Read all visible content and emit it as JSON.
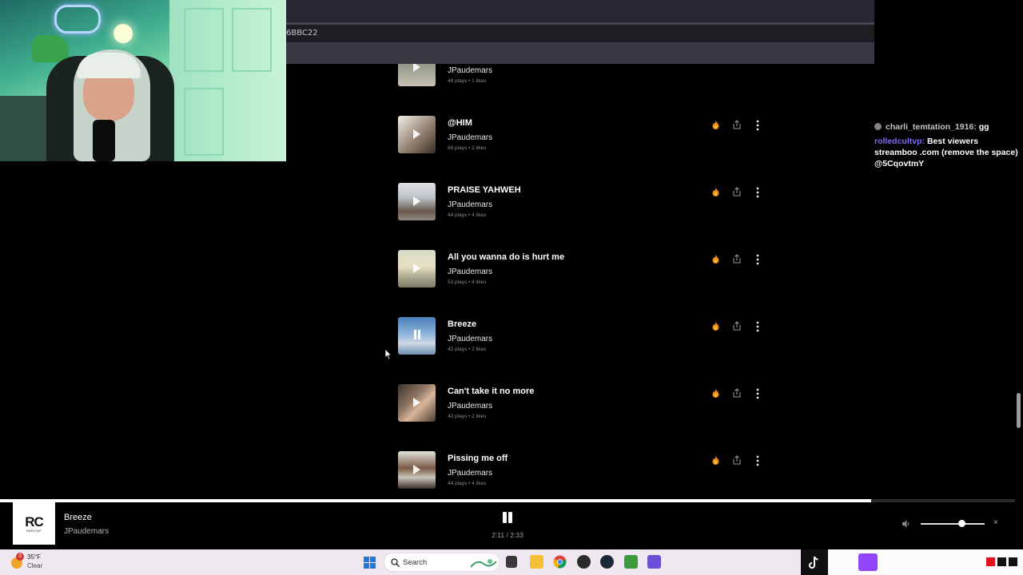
{
  "browser": {
    "url_fragment": "6BBC22"
  },
  "chat": {
    "messages": [
      {
        "user": "charli_temtation_1916:",
        "text": "gg"
      },
      {
        "user": "rolledcultvp:",
        "text": "Best viewers streamboo .com (remove the space) @5CqovtmY"
      }
    ]
  },
  "tracks": [
    {
      "title": "",
      "artist": "JPaudemars",
      "stats": "48 plays • 1 likes"
    },
    {
      "title": "@HIM",
      "artist": "JPaudemars",
      "stats": "66 plays • 2 likes"
    },
    {
      "title": "PRAISE YAHWEH",
      "artist": "JPaudemars",
      "stats": "44 plays • 4 likes"
    },
    {
      "title": "All you wanna do is hurt me",
      "artist": "JPaudemars",
      "stats": "53 plays • 4 likes"
    },
    {
      "title": "Breeze",
      "artist": "JPaudemars",
      "stats": "42 plays • 2 likes"
    },
    {
      "title": "Can't take it no more",
      "artist": "JPaudemars",
      "stats": "42 plays • 2 likes"
    },
    {
      "title": "Pissing me off",
      "artist": "JPaudemars",
      "stats": "44 plays • 4 likes"
    }
  ],
  "player": {
    "cover_mark": "RC",
    "cover_sub": "RAPCHAT",
    "title": "Breeze",
    "artist": "JPaudemars",
    "time": "2:11 / 2:33",
    "progress_fraction": 0.858,
    "volume_fraction": 0.64,
    "close_label": "×"
  },
  "taskbar": {
    "weather_temp": "35°F",
    "weather_cond": "Clear",
    "weather_badge": "3",
    "search_label": "Search"
  },
  "colors": {
    "fire": "#f08a1c",
    "accent_purple": "#9146ff",
    "tray_red": "#e0141e"
  }
}
